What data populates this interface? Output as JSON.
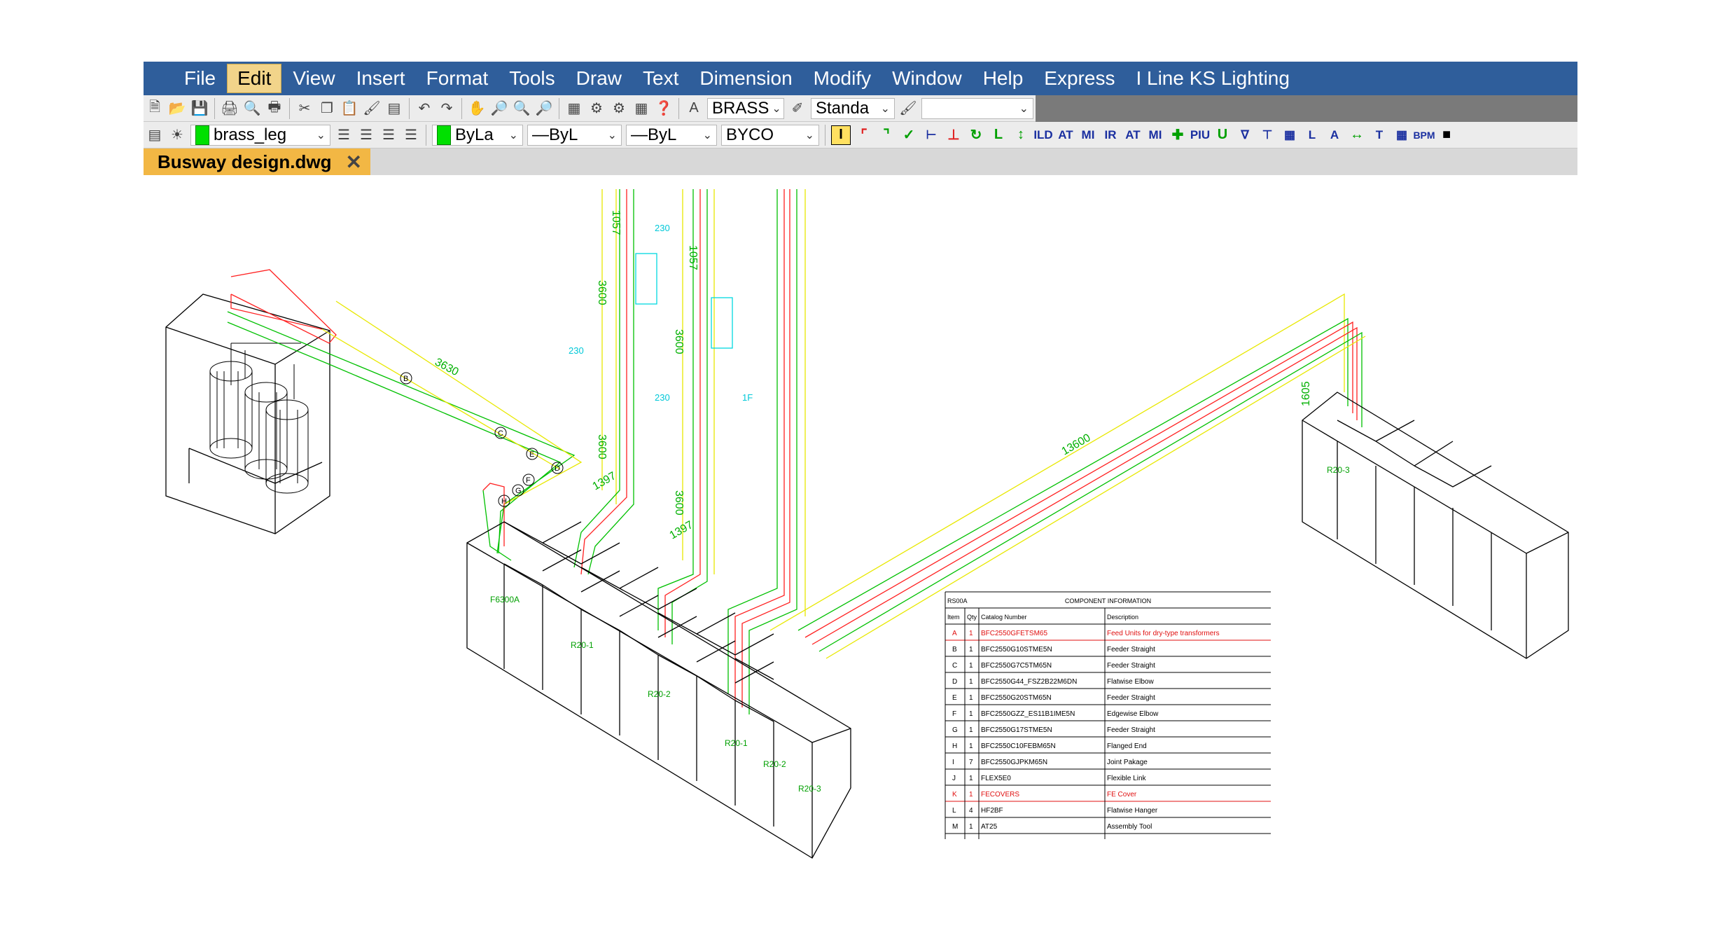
{
  "menu": [
    "File",
    "Edit",
    "View",
    "Insert",
    "Format",
    "Tools",
    "Draw",
    "Text",
    "Dimension",
    "Modify",
    "Window",
    "Help",
    "Express",
    "I Line KS Lighting"
  ],
  "active_menu": "Edit",
  "toolbar1": {
    "text_style": "BRASS",
    "dim_style": "Standa",
    "icons": [
      "new-icon",
      "open-icon",
      "save-icon",
      "print-icon",
      "print-preview-icon",
      "plot-icon",
      "cut-icon",
      "copy-icon",
      "paste-icon",
      "match-properties-icon",
      "block-icon",
      "undo-icon",
      "redo-icon",
      "pan-icon",
      "zoom-realtime-icon",
      "zoom-window-icon",
      "zoom-previous-icon",
      "properties-icon",
      "design-center-icon",
      "tool-palette-icon",
      "calculator-icon",
      "help-icon"
    ]
  },
  "toolbar2": {
    "layer": "brass_leg",
    "color": "ByLa",
    "linetype": "ByL",
    "lineweight": "ByL",
    "plotstyle": "BYCO",
    "tool_labels": [
      "I",
      "ILD",
      "AT",
      "MI",
      "IR",
      "AT",
      "MI",
      "PIU",
      "BPM"
    ]
  },
  "tab": {
    "title": "Busway design.dwg"
  },
  "drawing": {
    "dims": [
      "3630",
      "1397",
      "1397",
      "3600",
      "3600",
      "3600",
      "3600",
      "13600",
      "1605",
      "1057",
      "1057",
      "230",
      "230",
      "230",
      "1F"
    ],
    "run_labels": [
      "F6300A",
      "R20-1",
      "R20-2",
      "R20-1",
      "R20-2",
      "R20-3",
      "R20-3"
    ],
    "bubbles": [
      "B",
      "C",
      "D",
      "E",
      "F",
      "G",
      "H"
    ]
  },
  "component_table": {
    "code": "RS00A",
    "title": "COMPONENT INFORMATION",
    "headers": [
      "Item",
      "Qty",
      "Catalog Number",
      "Description"
    ],
    "rows": [
      {
        "item": "A",
        "qty": "1",
        "catalog": "BFC2550GFETSM65",
        "desc": "Feed Units for dry-type transformers",
        "color": "#e01010"
      },
      {
        "item": "B",
        "qty": "1",
        "catalog": "BFC2550G10STME5N",
        "desc": "Feeder Straight",
        "color": "#000000"
      },
      {
        "item": "C",
        "qty": "1",
        "catalog": "BFC2550G7C5TM65N",
        "desc": "Feeder Straight",
        "color": "#000000"
      },
      {
        "item": "D",
        "qty": "1",
        "catalog": "BFC2550G44_FSZ2B22M6DN",
        "desc": "Flatwise Elbow",
        "color": "#000000"
      },
      {
        "item": "E",
        "qty": "1",
        "catalog": "BFC2550G20STM65N",
        "desc": "Feeder Straight",
        "color": "#000000"
      },
      {
        "item": "F",
        "qty": "1",
        "catalog": "BFC2550GZZ_ES11B1IME5N",
        "desc": "Edgewise Elbow",
        "color": "#000000"
      },
      {
        "item": "G",
        "qty": "1",
        "catalog": "BFC2550G17STME5N",
        "desc": "Feeder Straight",
        "color": "#000000"
      },
      {
        "item": "H",
        "qty": "1",
        "catalog": "BFC2550C10FEBM65N",
        "desc": "Flanged End",
        "color": "#000000"
      },
      {
        "item": "I",
        "qty": "7",
        "catalog": "BFC2550GJPKM65N",
        "desc": "Joint Pakage",
        "color": "#000000"
      },
      {
        "item": "J",
        "qty": "1",
        "catalog": "FLEX5E0",
        "desc": "Flexible Link",
        "color": "#000000"
      },
      {
        "item": "K",
        "qty": "1",
        "catalog": "FECOVERS",
        "desc": "FE Cover",
        "color": "#e01010"
      },
      {
        "item": "L",
        "qty": "4",
        "catalog": "HF2BF",
        "desc": "Flatwise Hanger",
        "color": "#000000"
      },
      {
        "item": "M",
        "qty": "1",
        "catalog": "AT25",
        "desc": "Assembly Tool",
        "color": "#000000"
      }
    ]
  }
}
